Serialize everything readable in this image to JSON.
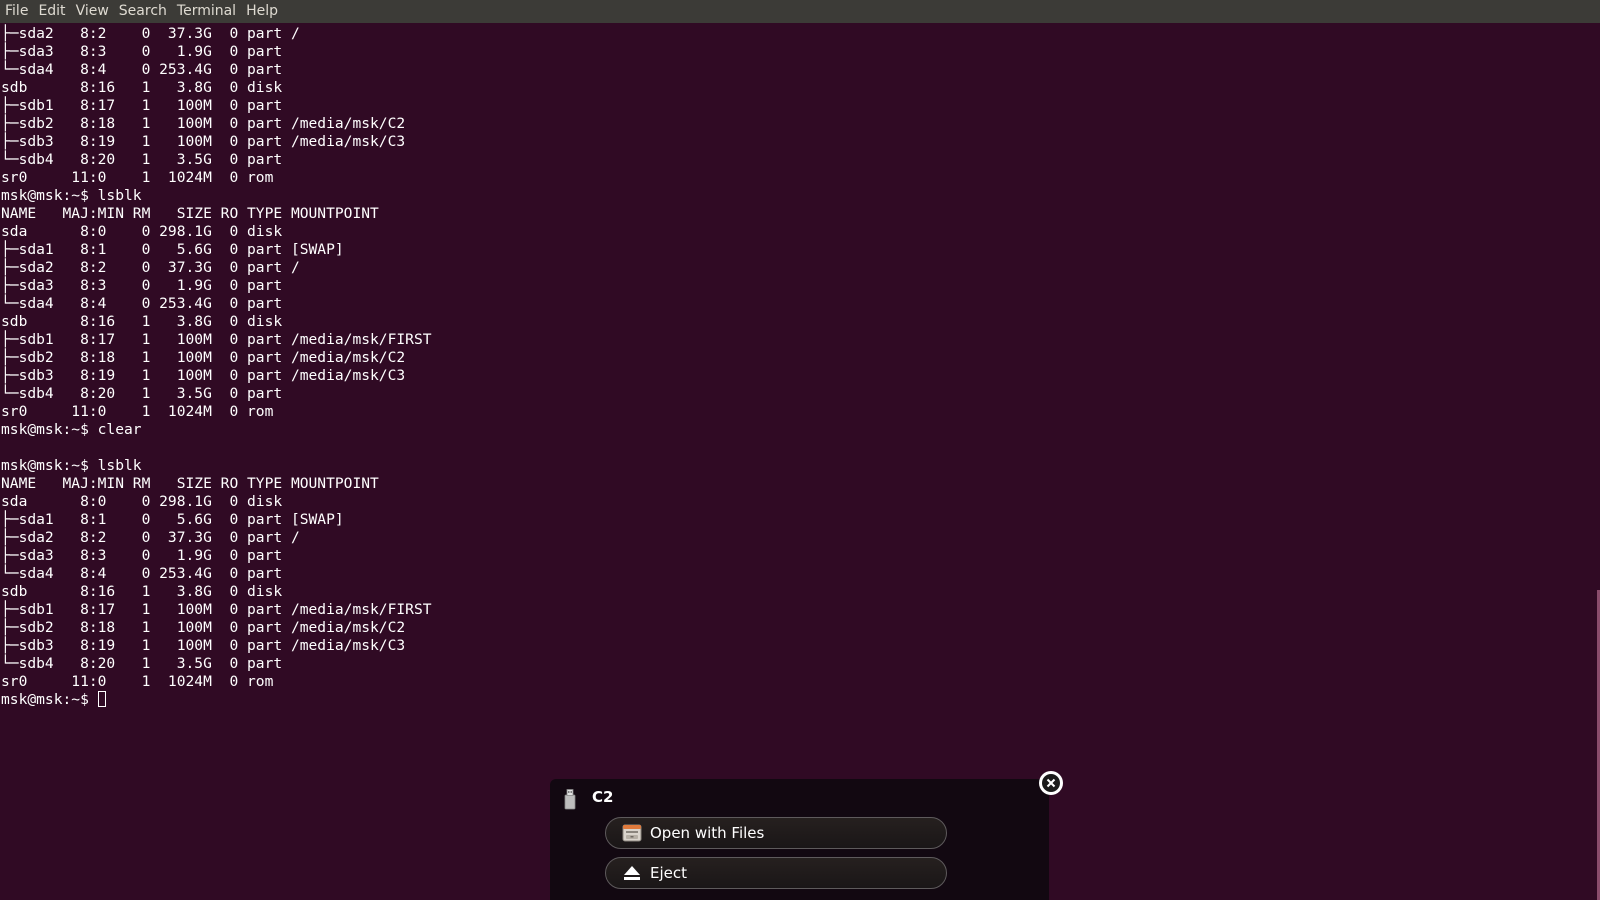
{
  "menubar": {
    "items": [
      "File",
      "Edit",
      "View",
      "Search",
      "Terminal",
      "Help"
    ]
  },
  "terminal": {
    "lines": [
      "├─sda2   8:2    0  37.3G  0 part /",
      "├─sda3   8:3    0   1.9G  0 part ",
      "└─sda4   8:4    0 253.4G  0 part ",
      "sdb      8:16   1   3.8G  0 disk ",
      "├─sdb1   8:17   1   100M  0 part ",
      "├─sdb2   8:18   1   100M  0 part /media/msk/C2",
      "├─sdb3   8:19   1   100M  0 part /media/msk/C3",
      "└─sdb4   8:20   1   3.5G  0 part ",
      "sr0     11:0    1  1024M  0 rom  ",
      "msk@msk:~$ lsblk",
      "NAME   MAJ:MIN RM   SIZE RO TYPE MOUNTPOINT",
      "sda      8:0    0 298.1G  0 disk ",
      "├─sda1   8:1    0   5.6G  0 part [SWAP]",
      "├─sda2   8:2    0  37.3G  0 part /",
      "├─sda3   8:3    0   1.9G  0 part ",
      "└─sda4   8:4    0 253.4G  0 part ",
      "sdb      8:16   1   3.8G  0 disk ",
      "├─sdb1   8:17   1   100M  0 part /media/msk/FIRST",
      "├─sdb2   8:18   1   100M  0 part /media/msk/C2",
      "├─sdb3   8:19   1   100M  0 part /media/msk/C3",
      "└─sdb4   8:20   1   3.5G  0 part ",
      "sr0     11:0    1  1024M  0 rom  ",
      "msk@msk:~$ clear",
      "",
      "msk@msk:~$ lsblk",
      "NAME   MAJ:MIN RM   SIZE RO TYPE MOUNTPOINT",
      "sda      8:0    0 298.1G  0 disk ",
      "├─sda1   8:1    0   5.6G  0 part [SWAP]",
      "├─sda2   8:2    0  37.3G  0 part /",
      "├─sda3   8:3    0   1.9G  0 part ",
      "└─sda4   8:4    0 253.4G  0 part ",
      "sdb      8:16   1   3.8G  0 disk ",
      "├─sdb1   8:17   1   100M  0 part /media/msk/FIRST",
      "├─sdb2   8:18   1   100M  0 part /media/msk/C2",
      "├─sdb3   8:19   1   100M  0 part /media/msk/C3",
      "└─sdb4   8:20   1   3.5G  0 part ",
      "sr0     11:0    1  1024M  0 rom  "
    ],
    "prompt": "msk@msk:~$ "
  },
  "notification": {
    "title": "C2",
    "buttons": {
      "open_label": "Open with Files",
      "eject_label": "Eject"
    },
    "icons": {
      "device": "usb-drive-icon",
      "open": "file-manager-icon",
      "eject": "eject-icon",
      "close": "close-icon"
    }
  },
  "colors": {
    "terminal_bg": "#300a24",
    "terminal_fg": "#ffffff",
    "menubar_bg": "#3c3b37",
    "menubar_fg": "#dfdbd2",
    "notify_bg": "#120811"
  }
}
